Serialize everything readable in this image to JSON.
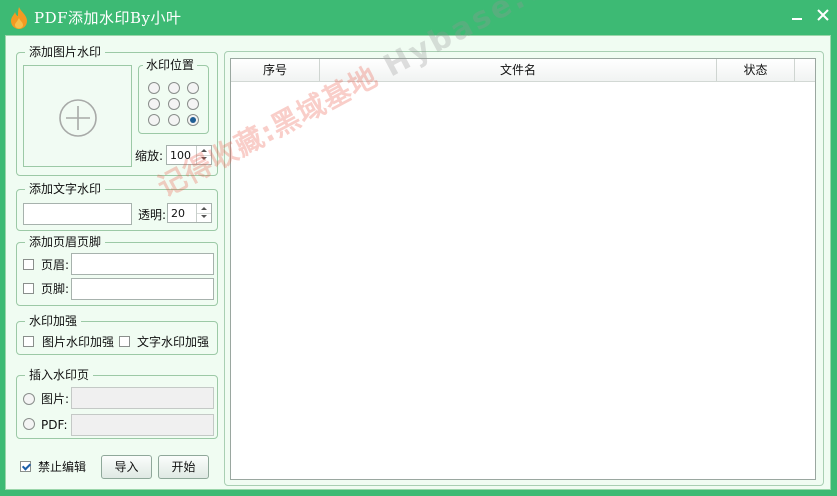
{
  "window": {
    "title": "PDF添加水印By小叶",
    "icon": "flame-icon",
    "accent": "#3dba74",
    "icon_color": "#f39a22"
  },
  "image_watermark": {
    "legend": "添加图片水印",
    "drop_icon": "plus-circle-icon",
    "position_legend": "水印位置",
    "position_selected": 9,
    "scale_label": "缩放:",
    "scale_value": "100"
  },
  "text_watermark": {
    "legend": "添加文字水印",
    "text_value": "",
    "opacity_label": "透明:",
    "opacity_value": "20"
  },
  "header_footer": {
    "legend": "添加页眉页脚",
    "header_label": "页眉:",
    "header_value": "",
    "header_checked": false,
    "footer_label": "页脚:",
    "footer_value": "",
    "footer_checked": false
  },
  "enhance": {
    "legend": "水印加强",
    "image_enhance_label": "图片水印加强",
    "image_enhance_checked": false,
    "text_enhance_label": "文字水印加强",
    "text_enhance_checked": false
  },
  "insert_page": {
    "legend": "插入水印页",
    "image_label": "图片:",
    "image_value": "",
    "pdf_label": "PDF:",
    "pdf_value": ""
  },
  "bottom": {
    "disable_edit_label": "禁止编辑",
    "disable_edit_checked": true,
    "import_label": "导入",
    "start_label": "开始"
  },
  "file_list": {
    "columns": [
      "序号",
      "文件名",
      "状态"
    ],
    "rows": []
  },
  "overlay_watermark": {
    "chinese": "记得收藏:黑域基地",
    "english": "Hybase.com"
  }
}
